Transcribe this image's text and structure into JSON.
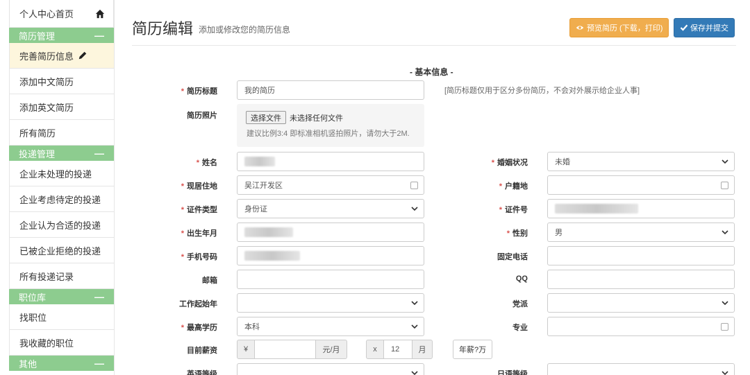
{
  "sidebar": {
    "home": "个人中心首页",
    "groups": [
      {
        "title": "简历管理",
        "items": [
          "完善简历信息",
          "添加中文简历",
          "添加英文简历",
          "所有简历"
        ]
      },
      {
        "title": "投递管理",
        "items": [
          "企业未处理的投递",
          "企业考虑待定的投递",
          "企业认为合适的投递",
          "已被企业拒绝的投递",
          "所有投递记录"
        ]
      },
      {
        "title": "职位库",
        "items": [
          "找职位",
          "我收藏的职位"
        ]
      },
      {
        "title": "其他",
        "items": []
      }
    ]
  },
  "header": {
    "title": "简历编辑",
    "subtitle": "添加或修改您的简历信息",
    "preview_button": "预览简历 (下载，打印)",
    "save_button": "保存并提交"
  },
  "form": {
    "section_title": "- 基本信息 -",
    "resume_title_label": "简历标题",
    "resume_title_value": "我的简历",
    "resume_title_hint": "[简历标题仅用于区分多份简历，不会对外展示给企业人事]",
    "photo_label": "简历照片",
    "file_button": "选择文件",
    "file_status": "未选择任何文件",
    "photo_hint": "建议比例3:4 即标准相机竖拍照片，请勿大于2M.",
    "name_label": "姓名",
    "marital_label": "婚姻状况",
    "marital_value": "未婚",
    "residence_label": "现居住地",
    "residence_value": "吴江开发区",
    "hukou_label": "户籍地",
    "id_type_label": "证件类型",
    "id_type_value": "身份证",
    "id_no_label": "证件号",
    "birth_label": "出生年月",
    "gender_label": "性别",
    "gender_value": "男",
    "mobile_label": "手机号码",
    "phone_label": "固定电话",
    "email_label": "邮箱",
    "qq_label": "QQ",
    "work_start_label": "工作起始年",
    "party_label": "党派",
    "education_label": "最高学历",
    "education_value": "本科",
    "major_label": "专业",
    "salary_label": "目前薪资",
    "currency_addon": "¥",
    "per_month_addon": "元/月",
    "times_addon": "x",
    "months_value": "12",
    "month_addon": "月",
    "annual_button": "年薪?万",
    "english_label": "英语等级",
    "japanese_label": "日语等级"
  }
}
